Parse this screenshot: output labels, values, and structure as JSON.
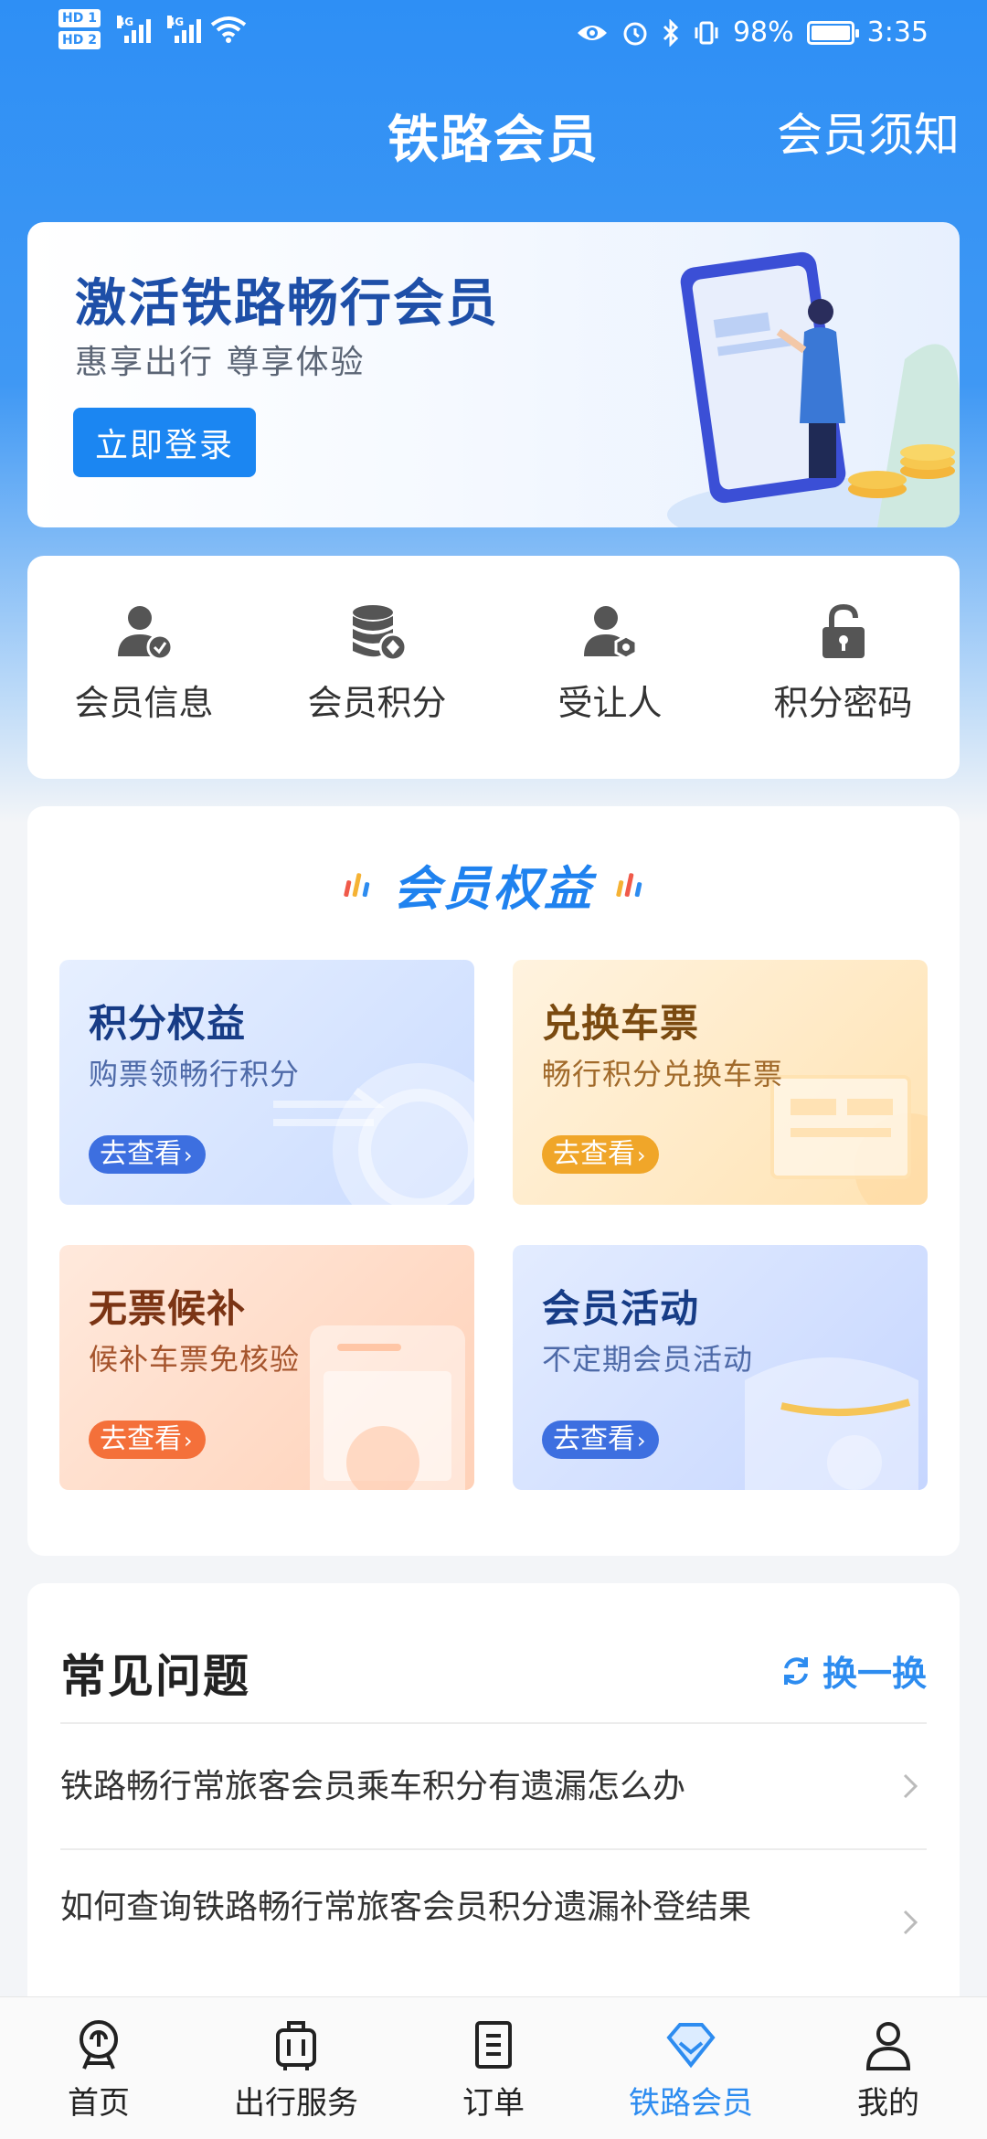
{
  "status_bar": {
    "sim1": "HD 1",
    "sim2": "HD 2",
    "net_type": "4G",
    "battery": "98%",
    "time": "3:35"
  },
  "header": {
    "title": "铁路会员",
    "notice": "会员须知"
  },
  "banner": {
    "title": "激活铁路畅行会员",
    "subtitle": "惠享出行 尊享体验",
    "button": "立即登录"
  },
  "quick_menu": [
    {
      "label": "会员信息",
      "icon": "member-info-icon"
    },
    {
      "label": "会员积分",
      "icon": "points-icon"
    },
    {
      "label": "受让人",
      "icon": "assignee-icon"
    },
    {
      "label": "积分密码",
      "icon": "lock-icon"
    }
  ],
  "benefits": {
    "title": "会员权益",
    "cards": [
      {
        "title": "积分权益",
        "subtitle": "购票领畅行积分",
        "button": "去查看"
      },
      {
        "title": "兑换车票",
        "subtitle": "畅行积分兑换车票",
        "button": "去查看"
      },
      {
        "title": "无票候补",
        "subtitle": "候补车票免核验",
        "button": "去查看"
      },
      {
        "title": "会员活动",
        "subtitle": "不定期会员活动",
        "button": "去查看"
      }
    ]
  },
  "faq": {
    "title": "常见问题",
    "refresh": "换一换",
    "items": [
      "铁路畅行常旅客会员乘车积分有遗漏怎么办",
      "如何查询铁路畅行常旅客会员积分遗漏补登结果"
    ]
  },
  "bottom_nav": [
    {
      "label": "首页",
      "icon": "home-icon"
    },
    {
      "label": "出行服务",
      "icon": "luggage-icon"
    },
    {
      "label": "订单",
      "icon": "order-icon"
    },
    {
      "label": "铁路会员",
      "icon": "diamond-icon",
      "active": true
    },
    {
      "label": "我的",
      "icon": "profile-icon"
    }
  ],
  "colors": {
    "primary": "#2e8ff5",
    "accent_blue": "#2d8cf0",
    "banner_title": "#1e4fa8"
  }
}
